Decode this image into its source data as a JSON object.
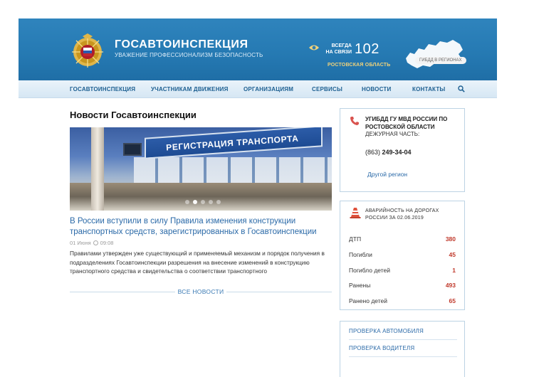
{
  "header": {
    "title": "ГОСАВТОИНСПЕКЦИЯ",
    "subtitle": "УВАЖЕНИЕ ПРОФЕССИОНАЛИЗМ БЕЗОПАСНОСТЬ",
    "always_line1": "ВСЕГДА",
    "always_line2": "НА СВЯЗИ",
    "phone_short": "102",
    "region": "РОСТОВСКАЯ ОБЛАСТЬ",
    "map_badge": "ГИБДД В РЕГИОНАХ",
    "colors": {
      "header_bg": "#2a7db6",
      "region_text": "#f1d27a"
    }
  },
  "nav": {
    "items": [
      {
        "label": "ГОСАВТОИНСПЕКЦИЯ"
      },
      {
        "label": "УЧАСТНИКАМ ДВИЖЕНИЯ"
      },
      {
        "label": "ОРГАНИЗАЦИЯМ"
      },
      {
        "label": "СЕРВИСЫ"
      },
      {
        "label": "НОВОСТИ"
      },
      {
        "label": "КОНТАКТЫ"
      }
    ],
    "search_icon": "search-icon"
  },
  "main": {
    "page_title": "Новости Госавтоинспекции",
    "hero_text": "РЕГИСТРАЦИЯ ТРАНСПОРТА",
    "slider_dots_total": 5,
    "slider_active": 1,
    "news": {
      "title": "В России вступили в силу Правила изменения конструкции транспортных средств, зарегистрированных в Госавтоинспекции",
      "date": "01 Июня",
      "time": "09:08",
      "body": "Правилами утвержден уже существующий и применяемый механизм и порядок получения в подразделениях Госавтоинспекции разрешения на внесение изменений в конструкцию транспортного средства и свидетельства о соответствии транспортного"
    },
    "all_news": "ВСЕ НОВОСТИ"
  },
  "contact_box": {
    "dept": "УГИБДД ГУ МВД РОССИИ ПО РОСТОВСКОЙ ОБЛАСТИ",
    "duty": "ДЕЖУРНАЯ ЧАСТЬ:",
    "phone_code": "(863)",
    "phone_number": "249-34-04",
    "other_region": "Другой регион"
  },
  "accidents": {
    "title": "АВАРИЙНОСТЬ НА ДОРОГАХ РОССИИ ЗА 02.06.2019",
    "rows": [
      {
        "label": "ДТП",
        "value": "380"
      },
      {
        "label": "Погибли",
        "value": "45"
      },
      {
        "label": "Погибло детей",
        "value": "1"
      },
      {
        "label": "Ранены",
        "value": "493"
      },
      {
        "label": "Ранено детей",
        "value": "65"
      }
    ],
    "value_color": "#c0392b"
  },
  "links": {
    "items": [
      {
        "label": "ПРОВЕРКА АВТОМОБИЛЯ"
      },
      {
        "label": "ПРОВЕРКА ВОДИТЕЛЯ"
      }
    ]
  }
}
